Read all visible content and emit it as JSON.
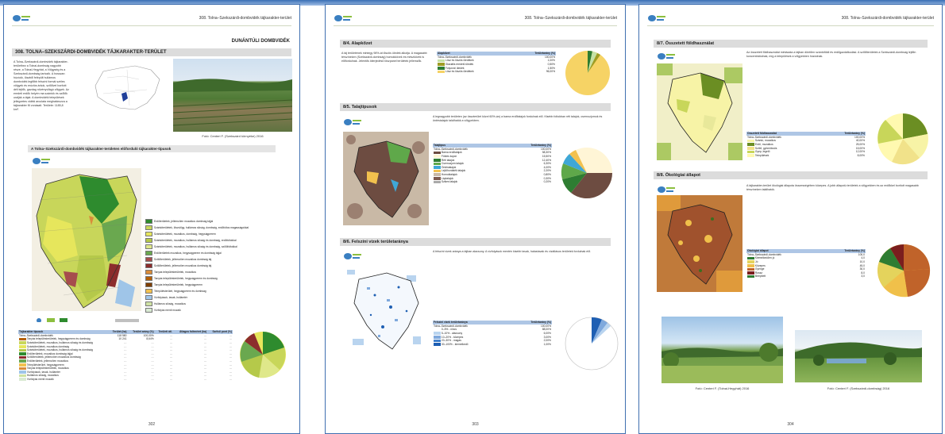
{
  "header_text": "308. Tolna–Szekszárdi-dombvidék tájkarakter-terület",
  "page1": {
    "region_heading": "DUNÁNTÚLI DOMBVIDÉK",
    "section_title": "308. TOLNA–SZEKSZÁRDI-DOMBVIDÉK TÁJKARAKTER-TERÜLET",
    "intro_text": "A Tolna–Szekszárdi-dombvidék tájkarakter-területhez a Tolnai-dombság nagyobb része, a Tolnai-Hegyhát, a Völgység és a Szekszárdi-dombság tartozik. A hosszan húzódó, löszből felépült hullámos dombvidék legfőbb felszíni formái széles völgyek és eróziós árkok, szőlővel borított déli lejtők, gazdag növényvilágú völgyek. Az eredeti erdők helyén ma szántók és szőlők uralják a tájat. A dombvidéki települések jellegzetes vidéki arculata meghatározza a tájkarakter fő vonásait. Területe: 1185,8 km².",
    "photo_caption": "Fotó: Centeri F. (Szekszárd környéke) 2016",
    "map_section_title": "A Tolna–Szekszárdi-dombvidék tájkarakter-területen előforduló tájkarakter-típusok",
    "legend": [
      {
        "label": "Erdőterületek, jellemzően mozaikos dombság tájjal",
        "color": "#2e8b2e"
      },
      {
        "label": "Szántóterületek, löszvölgy, hullámos síkság, dombság, erdőfoltos magasságokkal",
        "color": "#c8d65a"
      },
      {
        "label": "Szántóterületek, mozaikos, dombság, hegyságperem",
        "color": "#e6e65c"
      },
      {
        "label": "Szántóterületek, mozaikos, hullámos síkság és dombság, erdőfoltokkal",
        "color": "#b5c94a"
      },
      {
        "label": "Szántóterületek, mozaikos, hullámos síkság és dombság, szőlőfoltokkal",
        "color": "#dfe88a"
      },
      {
        "label": "Erdőterületek mozaikos, hegyságperem és dombság tájjal",
        "color": "#6aa84f"
      },
      {
        "label": "Szőlőterületek, jellemzően mozaikos dombság táj",
        "color": "#a64d4d"
      },
      {
        "label": "Szőlőterületek, jellemzően mozaikos dombság táj",
        "color": "#8c2d2d"
      },
      {
        "label": "Tanyás településterületek, mozaikos",
        "color": "#d98c3a"
      },
      {
        "label": "Tanyás településterületek, hegyságperem és dombság",
        "color": "#b45f06"
      },
      {
        "label": "Tanyás településterületek, hegyságperem",
        "color": "#7f3f00"
      },
      {
        "label": "Településterület, hegyságperem és dombság",
        "color": "#f2c14e"
      },
      {
        "label": "Vízfolyások, tavak, hullámtér",
        "color": "#9fc5e8"
      },
      {
        "label": "Hullámos síkság, mozaikos",
        "color": "#cfe2a3"
      },
      {
        "label": "Vízfolyás menti mozaik",
        "color": "#d9ead3"
      }
    ],
    "table_header": [
      "Tájkarakter típusok",
      "Terület (ha)",
      "Terület arány (%)",
      "Területi átl.",
      "Átlagos foltméret (ha)",
      "Szélső pont (%)"
    ],
    "table_rows": [
      [
        "Tolna–Szekszárdi-dombvidék",
        "118 580",
        "100,00%",
        "…",
        "…",
        "…"
      ],
      [
        "Tanyás településterületek, hegyságperem és dombság",
        "10 241",
        "8,64%",
        "…",
        "…",
        "…"
      ],
      [
        "Szántóterületek, mozaikos, hullámos síkság és dombság",
        "…",
        "…",
        "…",
        "…",
        "…"
      ],
      [
        "Szántóterületek, mozaikos dombság",
        "…",
        "…",
        "…",
        "…",
        "…"
      ],
      [
        "Szántóterületek, mozaikos, hullámos síkság és dombság",
        "…",
        "…",
        "…",
        "…",
        "…"
      ],
      [
        "Erdőterületek, mozaikos dombság tájjal",
        "…",
        "…",
        "…",
        "…",
        "…"
      ],
      [
        "Szőlőterületek, jellemzően mozaikos dombság",
        "…",
        "…",
        "…",
        "…",
        "…"
      ],
      [
        "Erdőterületek, jellemzően mozaikos",
        "…",
        "…",
        "…",
        "…",
        "…"
      ],
      [
        "Településterület, hegyságperem",
        "…",
        "…",
        "…",
        "…",
        "…"
      ],
      [
        "Tanyás településterületek, mozaikos",
        "…",
        "…",
        "…",
        "…",
        "…"
      ],
      [
        "Vízfolyások, tavak, hullámtér",
        "…",
        "…",
        "…",
        "…",
        "…"
      ],
      [
        "Hullámos síkság, mozaikos",
        "…",
        "…",
        "…",
        "…",
        "…"
      ],
      [
        "Vízfolyás menti mozaik",
        "…",
        "…",
        "…",
        "…",
        "…"
      ]
    ],
    "page_number": "302"
  },
  "page2": {
    "s1_title": "8/4. Alapkőzet",
    "s1_text": "A táj területének mintegy 98%-át löszös üledék alkotja. A magasabb térszíneken (Szekszárdi-dombság) homokkövek és mészkövek is előfordulnak. Jelentős kiterjedésű löszpanel területek jellemzők.",
    "s1_table": [
      [
        "Alapkőzet",
        "Területarány (%)"
      ],
      [
        "Tolna–Szekszárdi-dombvidék",
        "100,00%"
      ],
      [
        "Lösz és löszös üledékek",
        "1,00%"
      ],
      [
        "Glaciális eredetű üledék",
        "0,50%"
      ],
      [
        "Folyóvízi üledék",
        "1,50%"
      ],
      [
        "Lösz és löszös üledékek",
        "96,00%"
      ]
    ],
    "s2_title": "8/5. Talajtípusok",
    "s2_text": "A legnagyobb területen (az összterület közel 60%-án) a barna erdőtalajok fordulnak elő. Kisebb foltokban réti talajok, csernozjomok és öntéstalajok találhatók a völgyekben.",
    "s2_table": [
      [
        "Talajtípus",
        "Területarány (%)"
      ],
      [
        "Tolna–Szekszárdi-dombvidék",
        "100,00%"
      ],
      [
        "Barna erdőtalajok",
        "58,30%"
      ],
      [
        "Földes kopár",
        "15,50%"
      ],
      [
        "Réti talajok",
        "12,40%"
      ],
      [
        "Csernozjom talajok",
        "6,30%"
      ],
      [
        "Öntéstalajok",
        "4,00%"
      ],
      [
        "Lejtőhordalék talajok",
        "2,20%"
      ],
      [
        "Homoktalajok",
        "0,80%"
      ],
      [
        "Láptalajok",
        "0,30%"
      ],
      [
        "Szikes talajok",
        "0,20%"
      ]
    ],
    "s3_title": "8/6. Felszíni vizek területaránya",
    "s3_text": "A felszíni vizek aránya a tájban alacsony. A vízfolyások mentén kisebb tavak, halastavak és vízállásos területek fordulnak elő.",
    "s3_table": [
      [
        "Felszíni vizek területaránya",
        "Területarány (%)"
      ],
      [
        "Tolna–Szekszárdi-dombvidék",
        "100,00%"
      ],
      [
        "0–5% - nincs",
        "88,00%"
      ],
      [
        "5–10% - alacsony",
        "6,00%"
      ],
      [
        "10–20% - közepes",
        "3,00%"
      ],
      [
        "20–30% - magas",
        "2,00%"
      ],
      [
        "30–100% - kiemelkedő",
        "1,00%"
      ]
    ],
    "page_number": "303"
  },
  "page3": {
    "s1_title": "8/7. Összetett földhasználat",
    "s1_text": "Az összetett földhasználat mintázata a tájban döntően szántóföldi és erdőgazdálkodási. A szőlőterületek a Szekszárdi-dombság lejtőin koncentrálódnak, míg a települések a völgyekben húzódnak.",
    "s1_table": [
      [
        "Összetett földhasználat",
        "Területarány (%)"
      ],
      [
        "Tolna–Szekszárdi-dombvidék",
        "100,00%"
      ],
      [
        "Szántó, mozaikos",
        "40,00%"
      ],
      [
        "Erdő, mozaikos",
        "25,00%"
      ],
      [
        "Szőlő, gyümölcsös",
        "15,00%"
      ],
      [
        "Gyep, legelő",
        "12,00%"
      ],
      [
        "Települések",
        "8,00%"
      ]
    ],
    "s2_title": "8/8. Ökológiai állapot",
    "s2_text": "A tájkarakter-terület ökológiai állapota összességében közepes. A jobb állapotú területek a völgyekben és az erdőkkel borított magasabb térszíneken találhatók.",
    "s2_table": [
      [
        "Ökológiai állapot",
        "Területarány (%)"
      ],
      [
        "Tolna–Szekszárdi-dombvidék",
        "100,0"
      ],
      [
        "Kiemelkedően jó",
        "4,0"
      ],
      [
        "Jó",
        "10,0"
      ],
      [
        "Közepes",
        "45,0"
      ],
      [
        "Gyenge",
        "30,0"
      ],
      [
        "Rossz",
        "8,0"
      ],
      [
        "Beépített",
        "3,0"
      ]
    ],
    "photo1_caption": "Fotó: Centeri F. (Tolnai-Hegyhát) 2016",
    "photo2_caption": "Fotó: Centeri F. (Szekszárdi-dombság) 2016",
    "page_number": "304"
  }
}
